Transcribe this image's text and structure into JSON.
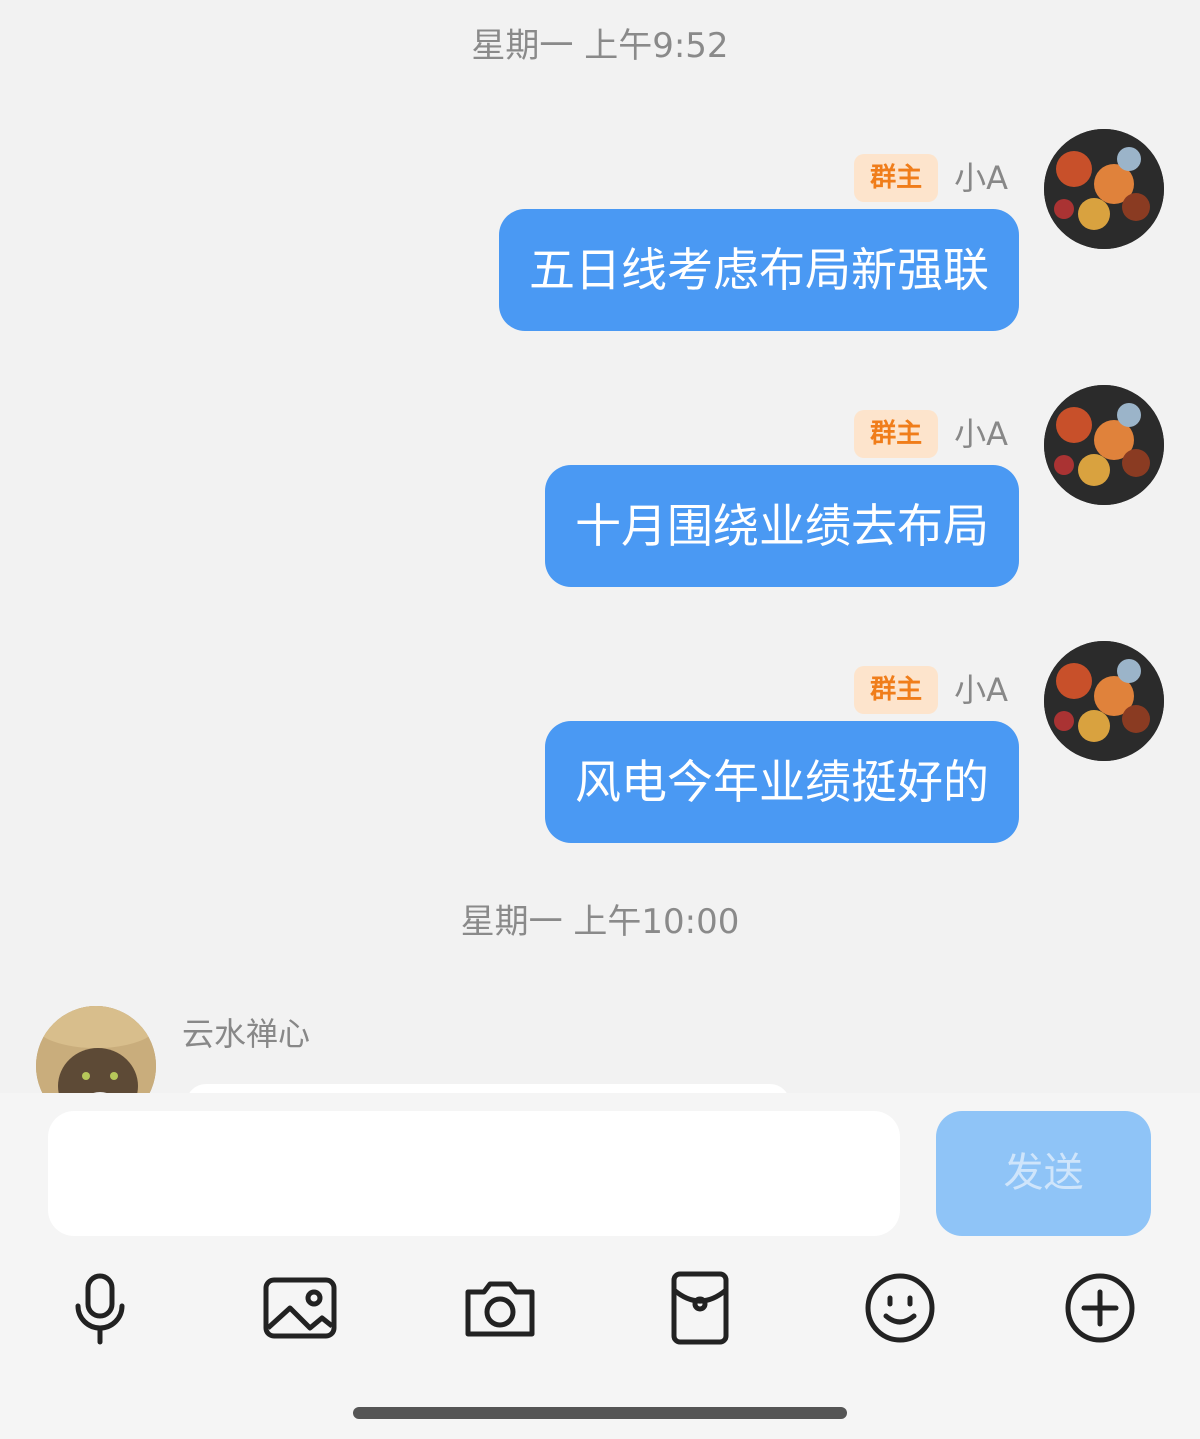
{
  "timestamps": [
    "星期一 上午9:52",
    "星期一 上午10:00"
  ],
  "outgoing_messages": [
    {
      "badge": "群主",
      "sender": "小A",
      "text": "五日线考虑布局新强联"
    },
    {
      "badge": "群主",
      "sender": "小A",
      "text": "十月围绕业绩去布局"
    },
    {
      "badge": "群主",
      "sender": "小A",
      "text": "风电今年业绩挺好的"
    }
  ],
  "incoming_message": {
    "sender": "云水禅心"
  },
  "input": {
    "placeholder": "",
    "value": ""
  },
  "send_button": {
    "label": "发送"
  },
  "toolbar_icons": [
    "microphone-icon",
    "image-icon",
    "camera-icon",
    "red-packet-icon",
    "emoji-icon",
    "plus-icon"
  ],
  "colors": {
    "background": "#f2f2f2",
    "bubble_out": "#4a99f3",
    "badge_bg": "#fde4cc",
    "badge_text": "#f07d1a",
    "send_button": "#8fc4f7"
  }
}
